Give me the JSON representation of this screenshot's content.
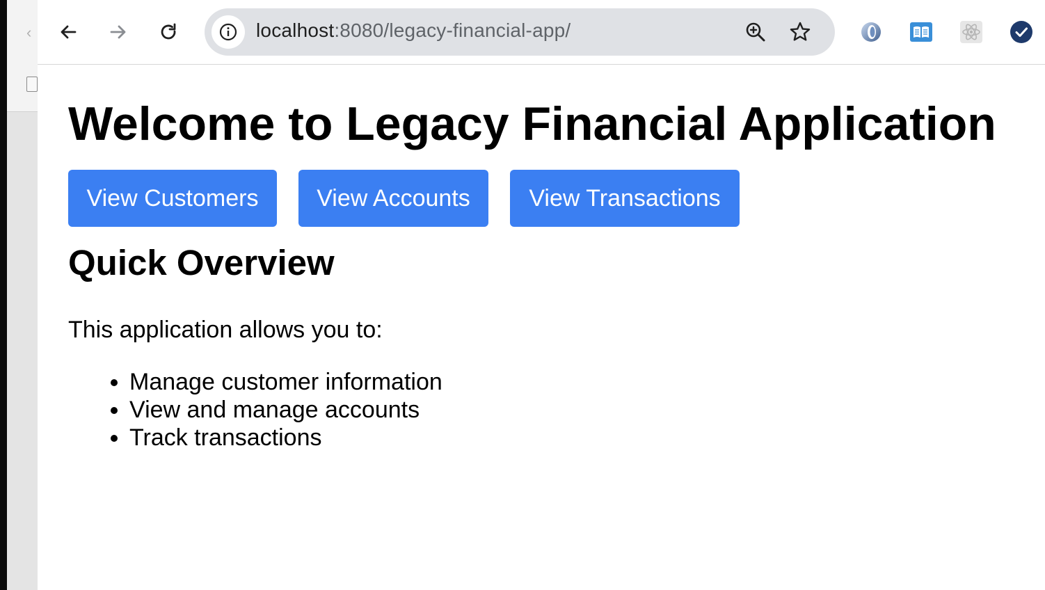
{
  "browser": {
    "url_host": "localhost",
    "url_rest": ":8080/legacy-financial-app/",
    "nav": {
      "back_icon": "arrow-left-icon",
      "forward_icon": "arrow-right-icon",
      "reload_icon": "reload-icon"
    },
    "omnibox_icons": [
      "info-icon",
      "zoom-icon",
      "bookmark-star-icon"
    ],
    "extensions": [
      "ring-extension-icon",
      "reader-extension-icon",
      "react-extension-icon",
      "profile-check-icon"
    ]
  },
  "page": {
    "title": "Welcome to Legacy Financial Application",
    "buttons": [
      {
        "label": "View Customers"
      },
      {
        "label": "View Accounts"
      },
      {
        "label": "View Transactions"
      }
    ],
    "overview": {
      "heading": "Quick Overview",
      "intro": "This application allows you to:",
      "items": [
        "Manage customer information",
        "View and manage accounts",
        "Track transactions"
      ]
    }
  },
  "colors": {
    "button_bg": "#3b7ff2",
    "button_text": "#ffffff",
    "omnibox_bg": "#dfe1e5"
  }
}
